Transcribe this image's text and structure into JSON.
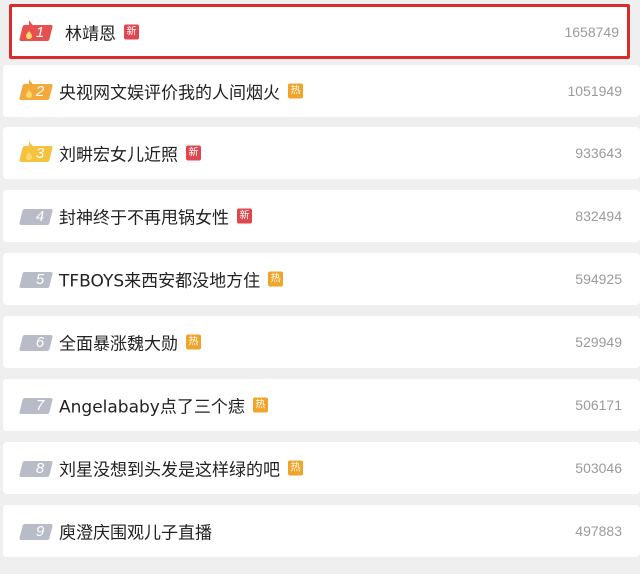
{
  "colors": {
    "selected_border": "#d92b2b",
    "rank_top1": "#e8504f",
    "rank_top2": "#f3a93b",
    "rank_top3": "#f7c23f",
    "rank_default": "#b8bcc6",
    "badge_new": "#e0464d",
    "badge_hot": "#f0a52a"
  },
  "items": [
    {
      "rank": "1",
      "title": "林靖恩",
      "badge": "新",
      "badge_type": "new",
      "count": "1658749",
      "flame": true,
      "rank_color": "#e8504f",
      "selected": true
    },
    {
      "rank": "2",
      "title": "央视网文娱评价我的人间烟火",
      "badge": "热",
      "badge_type": "hot",
      "count": "1051949",
      "flame": true,
      "rank_color": "#f3a93b",
      "selected": false
    },
    {
      "rank": "3",
      "title": "刘畊宏女儿近照",
      "badge": "新",
      "badge_type": "new",
      "count": "933643",
      "flame": true,
      "rank_color": "#f7c23f",
      "selected": false
    },
    {
      "rank": "4",
      "title": "封神终于不再甩锅女性",
      "badge": "新",
      "badge_type": "new",
      "count": "832494",
      "flame": false,
      "rank_color": "#b8bcc6",
      "selected": false
    },
    {
      "rank": "5",
      "title": "TFBOYS来西安都没地方住",
      "badge": "热",
      "badge_type": "hot",
      "count": "594925",
      "flame": false,
      "rank_color": "#b8bcc6",
      "selected": false
    },
    {
      "rank": "6",
      "title": "全面暴涨魏大勋",
      "badge": "热",
      "badge_type": "hot",
      "count": "529949",
      "flame": false,
      "rank_color": "#b8bcc6",
      "selected": false
    },
    {
      "rank": "7",
      "title": "Angelababy点了三个痣",
      "badge": "热",
      "badge_type": "hot",
      "count": "506171",
      "flame": false,
      "rank_color": "#b8bcc6",
      "selected": false
    },
    {
      "rank": "8",
      "title": "刘星没想到头发是这样绿的吧",
      "badge": "热",
      "badge_type": "hot",
      "count": "503046",
      "flame": false,
      "rank_color": "#b8bcc6",
      "selected": false
    },
    {
      "rank": "9",
      "title": "庾澄庆围观儿子直播",
      "badge": "",
      "badge_type": "",
      "count": "497883",
      "flame": false,
      "rank_color": "#b8bcc6",
      "selected": false
    }
  ]
}
